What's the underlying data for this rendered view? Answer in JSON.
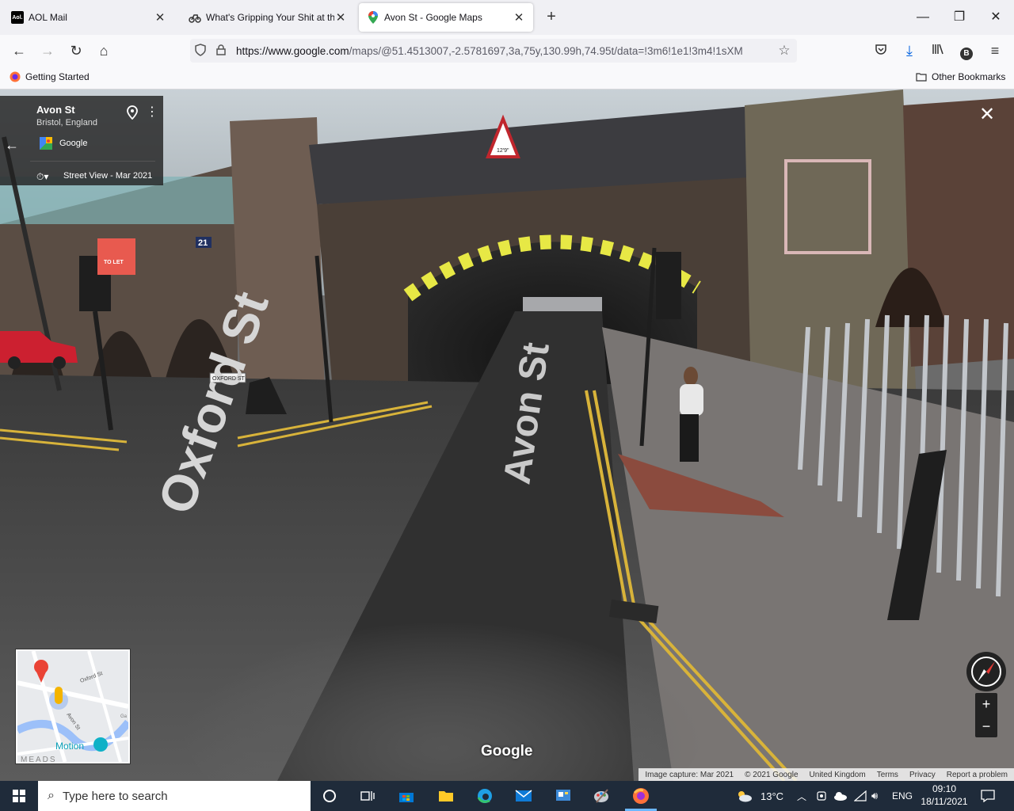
{
  "browser": {
    "tabs": [
      {
        "title": "AOL Mail",
        "favicon": "Aol."
      },
      {
        "title": "What's Gripping Your Shit at the",
        "favicon": "motorbike-icon"
      },
      {
        "title": "Avon St - Google Maps",
        "favicon": "maps-pin-icon",
        "active": true
      }
    ],
    "url_host": "https://www.google.com",
    "url_path": "/maps/@51.4513007,-2.5781697,3a,75y,130.99h,74.95t/data=!3m6!1e1!3m4!1sXM",
    "profile_initial": "B",
    "bookmarks": {
      "getting_started": "Getting Started",
      "other": "Other Bookmarks"
    }
  },
  "streetview": {
    "place": "Avon St",
    "region": "Bristol, England",
    "provider": "Google",
    "date_label": "Street View - Mar 2021",
    "watermark": "Google",
    "road_labels": {
      "oxford": "Oxford St",
      "avon": "Avon St"
    },
    "signs": {
      "oxford_sign": "OXFORD ST",
      "number_21": "21",
      "to_let": "TO LET",
      "height_limit": "12'9\""
    },
    "minimap": {
      "label_oxford": "Oxford St",
      "label_avon": "Avon St",
      "label_motion": "Motion",
      "label_meads": "MEADS",
      "label_ga": "Ga"
    },
    "footer": [
      "Image capture: Mar 2021",
      "© 2021 Google",
      "United Kingdom",
      "Terms",
      "Privacy",
      "Report a problem"
    ]
  },
  "taskbar": {
    "search_placeholder": "Type here to search",
    "weather": "13°C",
    "language": "ENG",
    "time": "09:10",
    "date": "18/11/2021"
  }
}
